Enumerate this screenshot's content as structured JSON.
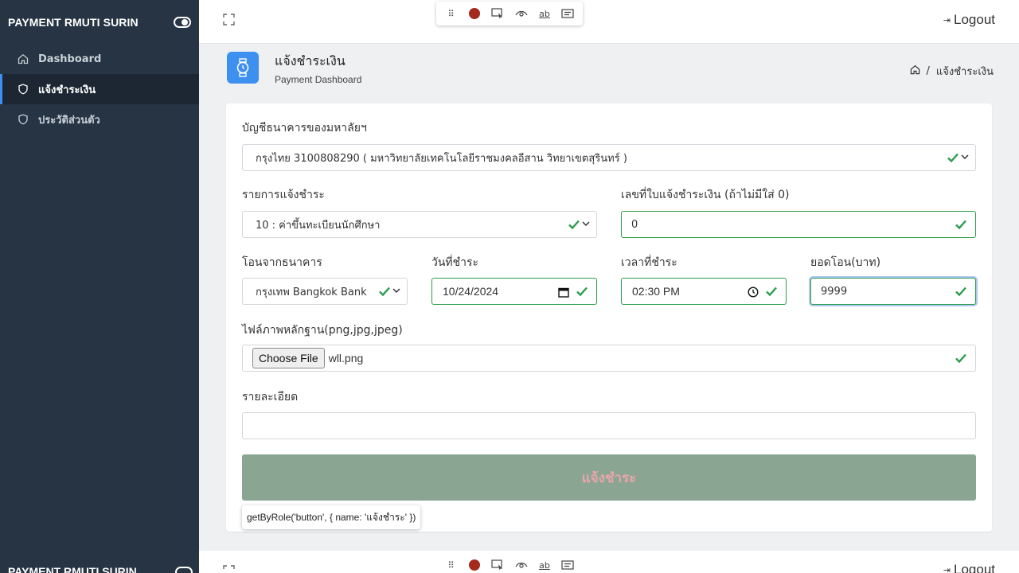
{
  "app": {
    "brand": "PAYMENT RMUTI SURIN"
  },
  "sidebar": {
    "items": [
      {
        "label": "Dashboard",
        "icon": "home-icon",
        "active": false
      },
      {
        "label": "แจ้งชำระเงิน",
        "icon": "shield-icon",
        "active": true
      },
      {
        "label": "ประวัติส่วนตัว",
        "icon": "shield-icon",
        "active": false
      }
    ]
  },
  "topbar": {
    "logout_label": "Logout"
  },
  "recorder": {
    "text_tool_label": "ab"
  },
  "page": {
    "title": "แจ้งชำระเงิน",
    "subtitle": "Payment Dashboard",
    "breadcrumb_separator": "/",
    "breadcrumb_current": "แจ้งชำระเงิน"
  },
  "form": {
    "bank_account_label": "บัญชีธนาคารของมหาลัยฯ",
    "bank_account_value": "กรุงไทย 3100808290 ( มหาวิทยาลัยเทคโนโลยีราชมงคลอีสาน วิทยาเขตสุรินทร์ )",
    "payment_item_label": "รายการแจ้งชำระ",
    "payment_item_value": "10 : ค่าขึ้นทะเบียนนักศึกษา",
    "invoice_no_label": "เลขที่ใบแจ้งชำระเงิน (ถ้าไม่มีใส่ 0)",
    "invoice_no_value": "0",
    "from_bank_label": "โอนจากธนาคาร",
    "from_bank_value": "กรุงเทพ Bangkok Bank",
    "pay_date_label": "วันที่ชำระ",
    "pay_date_value": "10/24/2024",
    "pay_time_label": "เวลาที่ชำระ",
    "pay_time_value": "02:30 PM",
    "amount_label": "ยอดโอน(บาท)",
    "amount_value": "9999",
    "file_label": "ไฟล์ภาพหลักฐาน(png,jpg,jpeg)",
    "file_button_label": "Choose File",
    "file_name": "wll.png",
    "details_label": "รายละเอียด",
    "details_value": "",
    "submit_label": "แจ้งชำระ"
  },
  "tooltip": {
    "text": "getByRole('button', { name: 'แจ้งชำระ' })"
  },
  "colors": {
    "sidebar_bg": "#263443",
    "accent": "#3d8ff0",
    "valid": "#2c9e4b",
    "submit_bg": "#8aa693",
    "submit_text": "#e8a5a9",
    "record": "#a52a1e"
  }
}
